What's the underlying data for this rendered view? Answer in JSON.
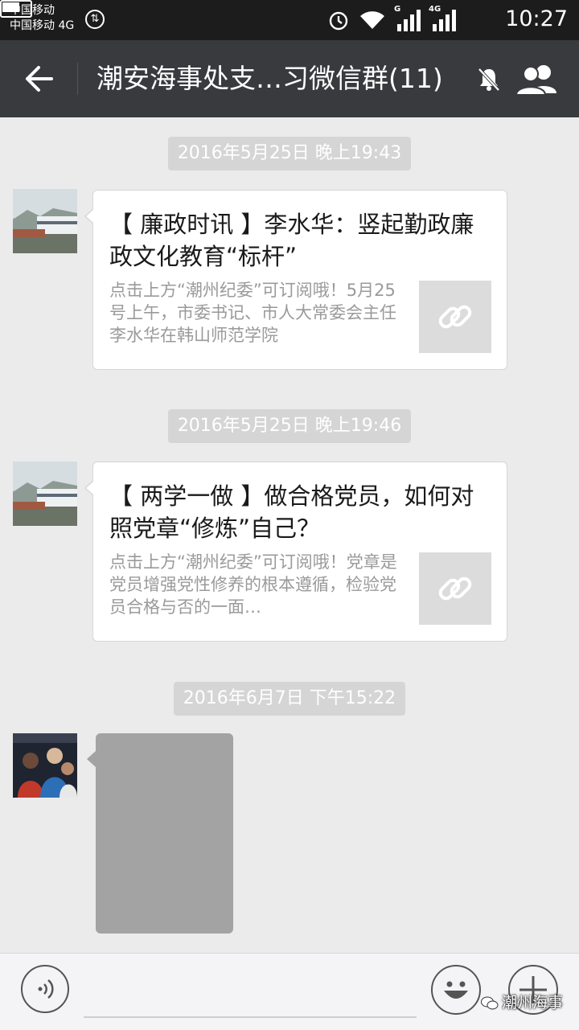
{
  "status_bar": {
    "carrier_1": "中国移动",
    "carrier_2": "中国移动 4G",
    "net_label_1": "G",
    "net_label_2": "4G",
    "time": "10:27",
    "battery_level": 0.7
  },
  "header": {
    "title": "潮安海事处支…习微信群(11)",
    "back_icon": "arrow-left-icon",
    "mute_icon": "bell-off-icon",
    "group_icon": "group-members-icon"
  },
  "messages": [
    {
      "timestamp": "2016年5月25日 晚上19:43",
      "type": "link",
      "title": "【 廉政时讯 】李水华：竖起勤政廉政文化教育“标杆”",
      "desc": "点击上方“潮州纪委”可订阅哦！5月25号上午，市委书记、市人大常委会主任李水华在韩山师范学院",
      "thumb_icon": "link-icon"
    },
    {
      "timestamp": "2016年5月25日 晚上19:46",
      "type": "link",
      "title": "【 两学一做 】做合格党员，如何对照党章“修炼”自己？",
      "desc": "点击上方“潮州纪委”可订阅哦！党章是党员增强党性修养的根本遵循，检验党员合格与否的一面…",
      "thumb_icon": "link-icon"
    },
    {
      "timestamp": "2016年6月7日 下午15:22",
      "type": "image"
    }
  ],
  "input_bar": {
    "voice_icon": "voice-icon",
    "emoji_icon": "emoji-icon",
    "plus_icon": "plus-icon"
  },
  "watermark": "潮州海事"
}
